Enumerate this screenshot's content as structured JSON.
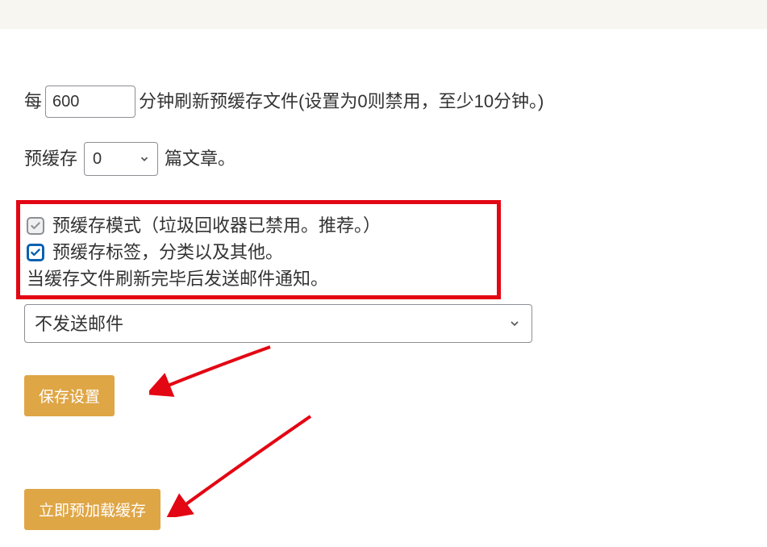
{
  "refresh": {
    "prefix": "每",
    "value": "600",
    "suffix": "分钟刷新预缓存文件(设置为0则禁用，至少10分钟。)"
  },
  "preload_count": {
    "prefix": "预缓存",
    "value": "0",
    "suffix": "篇文章。"
  },
  "checkbox1": {
    "label": "预缓存模式（垃圾回收器已禁用。推荐。）"
  },
  "checkbox2": {
    "label": "预缓存标签，分类以及其他。"
  },
  "notify_label": "当缓存文件刷新完毕后发送邮件通知。",
  "email_select": {
    "value": "不发送邮件"
  },
  "buttons": {
    "save": "保存设置",
    "preload_now": "立即预加载缓存"
  },
  "colors": {
    "highlight": "#e30613",
    "primary_button": "#dfa646",
    "checkbox_primary": "#0a60b0"
  }
}
